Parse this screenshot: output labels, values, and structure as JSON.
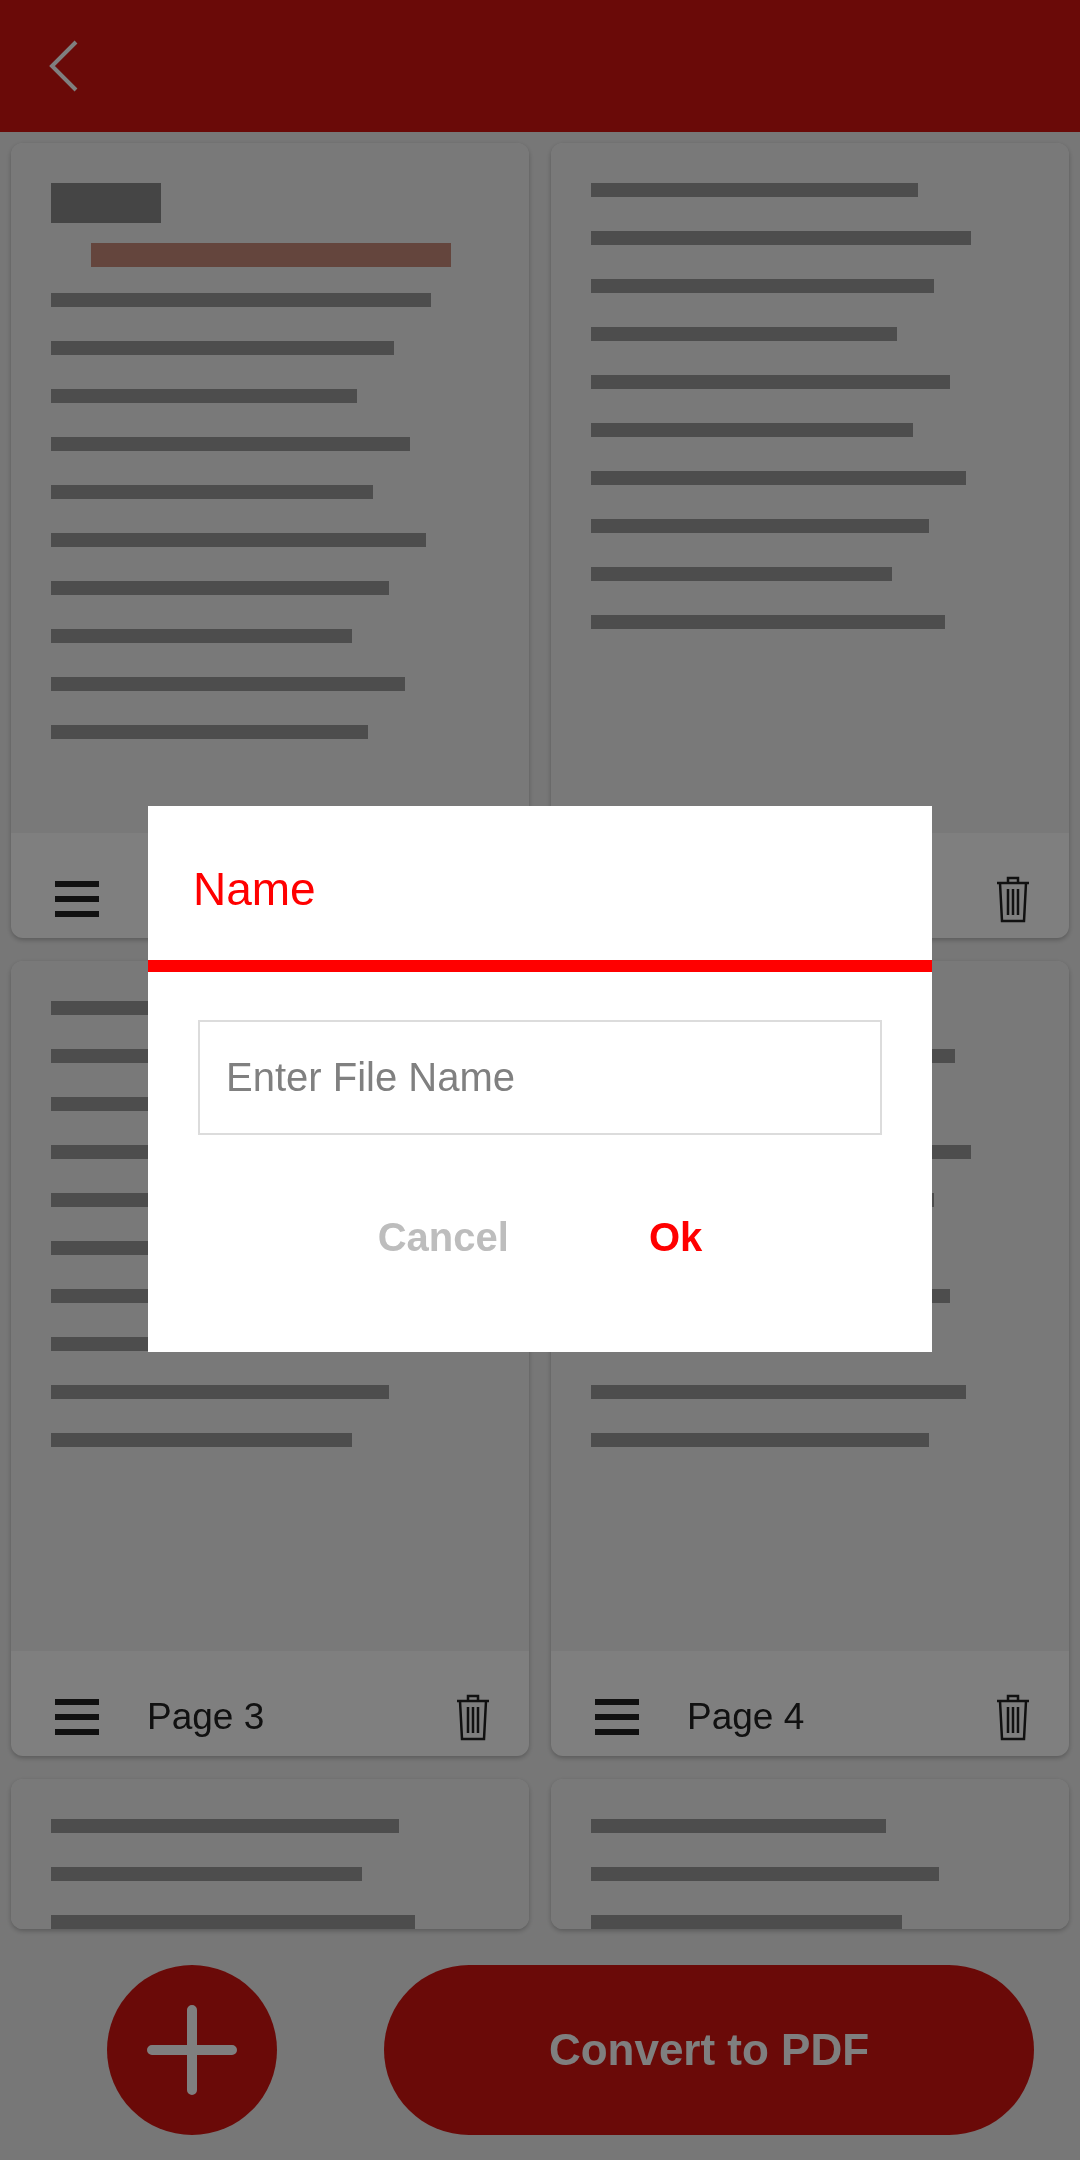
{
  "pages": [
    {
      "kind": "handle"
    },
    {
      "kind": "trash"
    },
    {
      "kind": "card",
      "label": "Page 3"
    },
    {
      "kind": "card",
      "label": "Page 4"
    },
    {
      "kind": "peek"
    },
    {
      "kind": "peek"
    }
  ],
  "bottom_bar": {
    "convert_button": "Convert to PDF"
  },
  "dialog": {
    "title": "Name",
    "input": {
      "placeholder": "Enter File Name"
    },
    "buttons": [
      {
        "kind": "cancel",
        "label": "Cancel"
      },
      {
        "kind": "ok",
        "label": "Ok"
      }
    ]
  }
}
